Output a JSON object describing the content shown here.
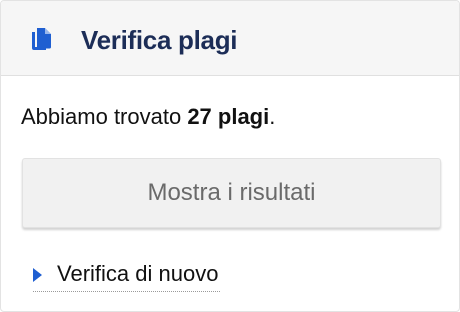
{
  "header": {
    "icon": "copy-documents-icon",
    "title": "Verifica plagi",
    "accent_color": "#1f5fd1"
  },
  "result": {
    "prefix": "Abbiamo trovato ",
    "count_text": "27 plagi",
    "suffix": "."
  },
  "actions": {
    "show_results_label": "Mostra i risultati",
    "recheck_label": "Verifica di nuovo",
    "recheck_icon": "triangle-right-icon"
  }
}
